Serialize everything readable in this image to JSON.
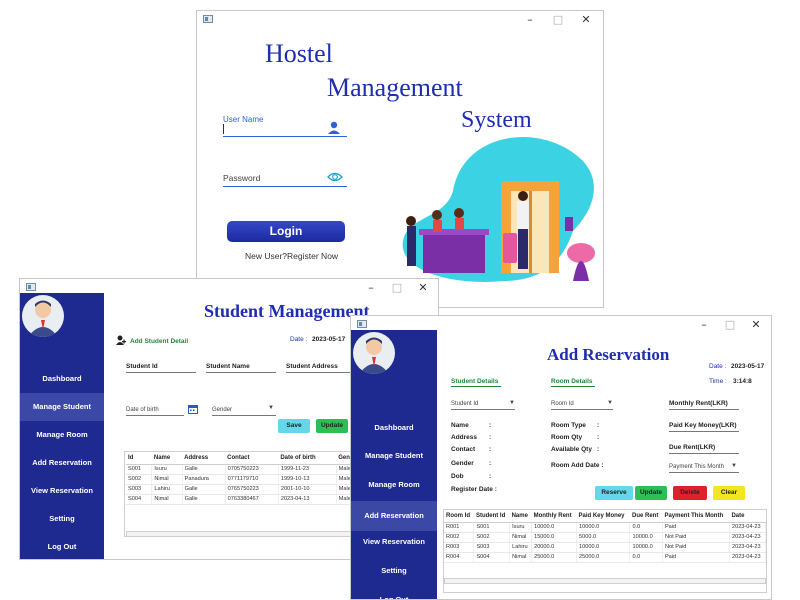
{
  "login": {
    "window_controls": [
      "–",
      "□",
      "✕"
    ],
    "title_line1": "Hostel",
    "title_line2": "Management",
    "title_line3": "System",
    "username_label": "User Name",
    "password_label": "Password",
    "login_label": "Login",
    "register_link": "New User?Register Now"
  },
  "student": {
    "window_controls": [
      "–",
      "□",
      "✕"
    ],
    "title": "Student Management",
    "add_detail": "Add Student Detail",
    "date_label": "Date :",
    "date_value": "2023-05-17",
    "field_student_id": "Student Id",
    "field_student_name": "Student Name",
    "field_student_address": "Student Address",
    "field_dob": "Date of birth",
    "field_gender": "Gender",
    "save_label": "Save",
    "update_label": "Update",
    "columns": [
      "Id",
      "Name",
      "Address",
      "Contact",
      "Date of birth",
      "Gen"
    ],
    "rows": [
      [
        "S001",
        "Isuru",
        "Galle",
        "0705750223",
        "1999-11-23",
        "Male"
      ],
      [
        "S002",
        "Nimal",
        "Panadura",
        "0771179710",
        "1999-10-13",
        "Male"
      ],
      [
        "S003",
        "Lahiru",
        "Galle",
        "0765750223",
        "2001-10-10",
        "Male"
      ],
      [
        "S004",
        "Nimal",
        "Galle",
        "0763380467",
        "2023-04-13",
        "Male"
      ]
    ]
  },
  "sidebar_student": [
    "Dashboard",
    "Manage Student",
    "Manage Room",
    "Add Reservation",
    "View Reservation",
    "Setting",
    "Log Out"
  ],
  "reservation": {
    "window_controls": [
      "–",
      "□",
      "✕"
    ],
    "title": "Add Reservation",
    "date_label": "Date :",
    "date_value": "2023-05-17",
    "time_label": "Time :",
    "time_value": "3:14:8",
    "student_details": "Student Details",
    "room_details": "Room Details",
    "student_id": "Student Id",
    "room_id": "Room Id",
    "monthly_rent": "Monthly Rent(LKR)",
    "paid_key_money": "Paid Key Money(LKR)",
    "due_rent": "Due Rent(LKR)",
    "payment_this_month": "Payment This Month",
    "name": "Name",
    "address": "Address",
    "contact": "Contact",
    "gender": "Gender",
    "dob": "Dob",
    "register_date": "Register Date :",
    "room_type": "Room Type",
    "room_qty": "Room Qty",
    "available_qty": "Available Qty",
    "room_add_date": "Room Add Date :",
    "colon": ":",
    "reserve_label": "Reserve",
    "update_label": "Update",
    "delete_label": "Delete",
    "clear_label": "Clear",
    "columns": [
      "Room Id",
      "Student Id",
      "Name",
      "Monthly Rent",
      "Paid Key Money",
      "Due Rent",
      "Payment This Month",
      "Date"
    ],
    "rows": [
      [
        "R001",
        "S001",
        "Isuru",
        "10000.0",
        "10000.0",
        "0.0",
        "Paid",
        "2023-04-23"
      ],
      [
        "R002",
        "S002",
        "Nimal",
        "15000.0",
        "5000.0",
        "10000.0",
        "Not Paid",
        "2023-04-23"
      ],
      [
        "R003",
        "S003",
        "Lahiru",
        "20000.0",
        "10000.0",
        "10000.0",
        "Not Paid",
        "2023-04-23"
      ],
      [
        "R004",
        "S004",
        "Nimal",
        "25000.0",
        "25000.0",
        "0.0",
        "Paid",
        "2023-04-23"
      ]
    ]
  },
  "sidebar_reservation": [
    "Dashboard",
    "Manage Student",
    "Manage Room",
    "Add Reservation",
    "View Reservation",
    "Setting",
    "Log Out"
  ],
  "colors": {
    "sidebar": "#1e2a8f",
    "active": "#3c48a6",
    "title": "#1f2db0",
    "green": "#1d8a3a"
  }
}
